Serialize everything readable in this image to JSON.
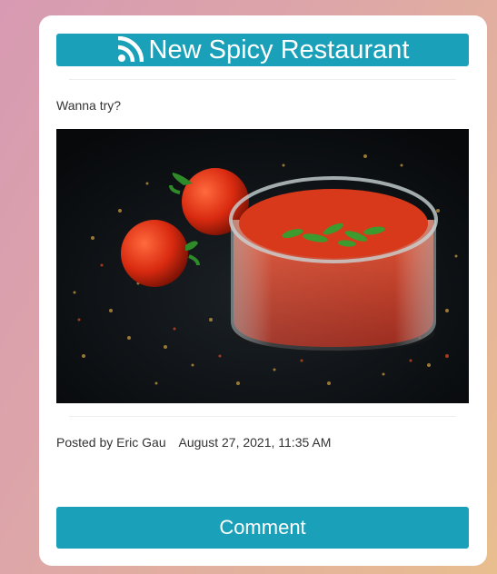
{
  "post": {
    "title": "New Spicy Restaurant",
    "title_icon": "rss-icon",
    "body": "Wanna try?",
    "image_subject": "tomato-sauce-photo",
    "author_line": "Posted by Eric Gau",
    "timestamp": "August 27, 2021, 11:35 AM"
  },
  "actions": {
    "comment_label": "Comment"
  },
  "colors": {
    "accent": "#1aa0b8",
    "card": "#ffffff",
    "text": "#333333"
  }
}
